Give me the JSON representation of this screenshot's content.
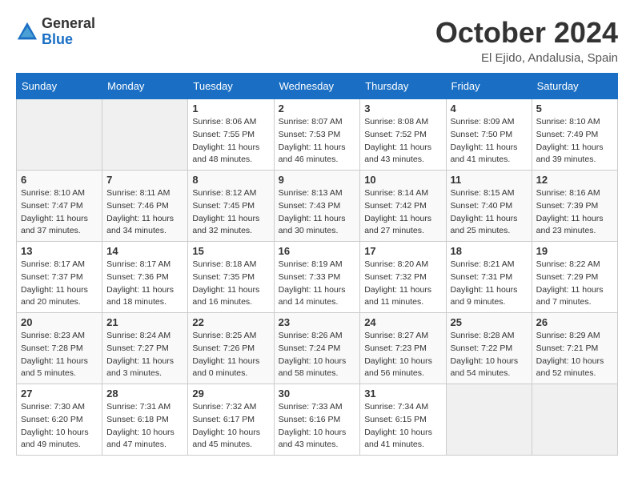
{
  "logo": {
    "line1": "General",
    "line2": "Blue"
  },
  "title": "October 2024",
  "subtitle": "El Ejido, Andalusia, Spain",
  "weekdays": [
    "Sunday",
    "Monday",
    "Tuesday",
    "Wednesday",
    "Thursday",
    "Friday",
    "Saturday"
  ],
  "weeks": [
    [
      {
        "day": "",
        "info": ""
      },
      {
        "day": "",
        "info": ""
      },
      {
        "day": "1",
        "info": "Sunrise: 8:06 AM\nSunset: 7:55 PM\nDaylight: 11 hours and 48 minutes."
      },
      {
        "day": "2",
        "info": "Sunrise: 8:07 AM\nSunset: 7:53 PM\nDaylight: 11 hours and 46 minutes."
      },
      {
        "day": "3",
        "info": "Sunrise: 8:08 AM\nSunset: 7:52 PM\nDaylight: 11 hours and 43 minutes."
      },
      {
        "day": "4",
        "info": "Sunrise: 8:09 AM\nSunset: 7:50 PM\nDaylight: 11 hours and 41 minutes."
      },
      {
        "day": "5",
        "info": "Sunrise: 8:10 AM\nSunset: 7:49 PM\nDaylight: 11 hours and 39 minutes."
      }
    ],
    [
      {
        "day": "6",
        "info": "Sunrise: 8:10 AM\nSunset: 7:47 PM\nDaylight: 11 hours and 37 minutes."
      },
      {
        "day": "7",
        "info": "Sunrise: 8:11 AM\nSunset: 7:46 PM\nDaylight: 11 hours and 34 minutes."
      },
      {
        "day": "8",
        "info": "Sunrise: 8:12 AM\nSunset: 7:45 PM\nDaylight: 11 hours and 32 minutes."
      },
      {
        "day": "9",
        "info": "Sunrise: 8:13 AM\nSunset: 7:43 PM\nDaylight: 11 hours and 30 minutes."
      },
      {
        "day": "10",
        "info": "Sunrise: 8:14 AM\nSunset: 7:42 PM\nDaylight: 11 hours and 27 minutes."
      },
      {
        "day": "11",
        "info": "Sunrise: 8:15 AM\nSunset: 7:40 PM\nDaylight: 11 hours and 25 minutes."
      },
      {
        "day": "12",
        "info": "Sunrise: 8:16 AM\nSunset: 7:39 PM\nDaylight: 11 hours and 23 minutes."
      }
    ],
    [
      {
        "day": "13",
        "info": "Sunrise: 8:17 AM\nSunset: 7:37 PM\nDaylight: 11 hours and 20 minutes."
      },
      {
        "day": "14",
        "info": "Sunrise: 8:17 AM\nSunset: 7:36 PM\nDaylight: 11 hours and 18 minutes."
      },
      {
        "day": "15",
        "info": "Sunrise: 8:18 AM\nSunset: 7:35 PM\nDaylight: 11 hours and 16 minutes."
      },
      {
        "day": "16",
        "info": "Sunrise: 8:19 AM\nSunset: 7:33 PM\nDaylight: 11 hours and 14 minutes."
      },
      {
        "day": "17",
        "info": "Sunrise: 8:20 AM\nSunset: 7:32 PM\nDaylight: 11 hours and 11 minutes."
      },
      {
        "day": "18",
        "info": "Sunrise: 8:21 AM\nSunset: 7:31 PM\nDaylight: 11 hours and 9 minutes."
      },
      {
        "day": "19",
        "info": "Sunrise: 8:22 AM\nSunset: 7:29 PM\nDaylight: 11 hours and 7 minutes."
      }
    ],
    [
      {
        "day": "20",
        "info": "Sunrise: 8:23 AM\nSunset: 7:28 PM\nDaylight: 11 hours and 5 minutes."
      },
      {
        "day": "21",
        "info": "Sunrise: 8:24 AM\nSunset: 7:27 PM\nDaylight: 11 hours and 3 minutes."
      },
      {
        "day": "22",
        "info": "Sunrise: 8:25 AM\nSunset: 7:26 PM\nDaylight: 11 hours and 0 minutes."
      },
      {
        "day": "23",
        "info": "Sunrise: 8:26 AM\nSunset: 7:24 PM\nDaylight: 10 hours and 58 minutes."
      },
      {
        "day": "24",
        "info": "Sunrise: 8:27 AM\nSunset: 7:23 PM\nDaylight: 10 hours and 56 minutes."
      },
      {
        "day": "25",
        "info": "Sunrise: 8:28 AM\nSunset: 7:22 PM\nDaylight: 10 hours and 54 minutes."
      },
      {
        "day": "26",
        "info": "Sunrise: 8:29 AM\nSunset: 7:21 PM\nDaylight: 10 hours and 52 minutes."
      }
    ],
    [
      {
        "day": "27",
        "info": "Sunrise: 7:30 AM\nSunset: 6:20 PM\nDaylight: 10 hours and 49 minutes."
      },
      {
        "day": "28",
        "info": "Sunrise: 7:31 AM\nSunset: 6:18 PM\nDaylight: 10 hours and 47 minutes."
      },
      {
        "day": "29",
        "info": "Sunrise: 7:32 AM\nSunset: 6:17 PM\nDaylight: 10 hours and 45 minutes."
      },
      {
        "day": "30",
        "info": "Sunrise: 7:33 AM\nSunset: 6:16 PM\nDaylight: 10 hours and 43 minutes."
      },
      {
        "day": "31",
        "info": "Sunrise: 7:34 AM\nSunset: 6:15 PM\nDaylight: 10 hours and 41 minutes."
      },
      {
        "day": "",
        "info": ""
      },
      {
        "day": "",
        "info": ""
      }
    ]
  ]
}
